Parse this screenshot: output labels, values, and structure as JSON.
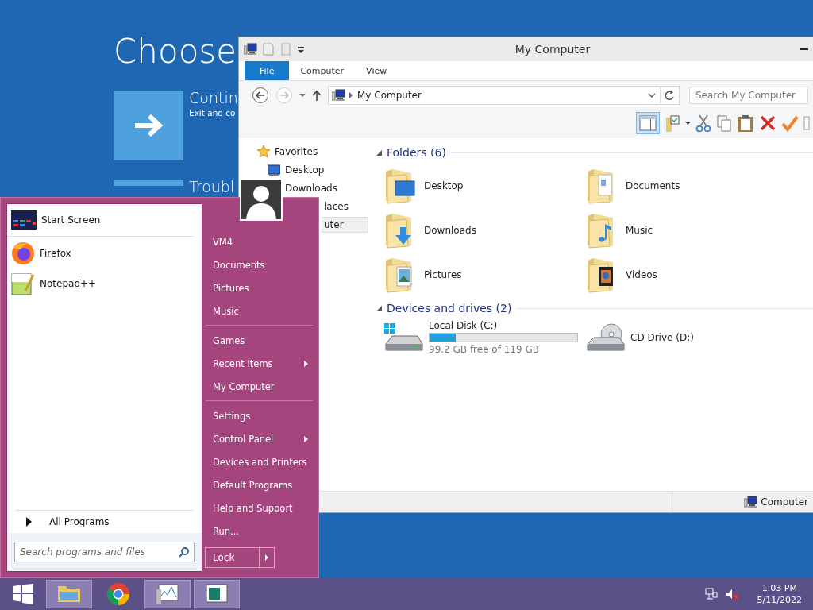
{
  "background_screen": {
    "title": "Choose",
    "options": [
      {
        "title": "Contin",
        "subtitle": "Exit and co",
        "kind": "continue"
      },
      {
        "title": "Troubl",
        "kind": "tools"
      }
    ]
  },
  "explorer": {
    "title": "My Computer",
    "tabs": [
      {
        "label": "File",
        "selected": true
      },
      {
        "label": "Computer",
        "selected": false
      },
      {
        "label": "View",
        "selected": false
      }
    ],
    "address": "My Computer",
    "search": {
      "placeholder": "Search My Computer"
    },
    "preview_pane": {
      "on": true
    },
    "nav_pane": [
      {
        "label": "Favorites",
        "kind": "group",
        "selected": false
      },
      {
        "label": "Desktop",
        "kind": "item",
        "selected": false
      },
      {
        "label": "Downloads",
        "kind": "item",
        "selected": false
      },
      {
        "label": "laces",
        "kind": "fragment",
        "selected": false
      },
      {
        "label": "uter",
        "kind": "fragment",
        "selected": true
      }
    ],
    "folders": {
      "header": "Folders (6)",
      "items": [
        {
          "label": "Desktop",
          "kind": "desktop"
        },
        {
          "label": "Documents",
          "kind": "documents"
        },
        {
          "label": "Downloads",
          "kind": "downloads"
        },
        {
          "label": "Music",
          "kind": "music"
        },
        {
          "label": "Pictures",
          "kind": "pictures"
        },
        {
          "label": "Videos",
          "kind": "videos"
        }
      ]
    },
    "drives": {
      "header": "Devices and drives (2)",
      "items": [
        {
          "label": "Local Disk (C:)",
          "kind": "disk",
          "level": 0.18,
          "detail": "99.2 GB free of 119 GB"
        },
        {
          "label": "CD Drive (D:)",
          "kind": "cd"
        }
      ]
    },
    "status_bar": {
      "label": "Computer"
    }
  },
  "start_menu": {
    "pinned": [
      {
        "label": "Start Screen",
        "kind": "start"
      },
      {
        "label": "Firefox",
        "kind": "firefox"
      },
      {
        "label": "Notepad++",
        "kind": "notepad"
      }
    ],
    "all_programs": "All Programs",
    "search": {
      "placeholder": "Search programs and files"
    },
    "places": [
      {
        "items": [
          {
            "label": "VM4",
            "has_submenu": false
          },
          {
            "label": "Documents",
            "has_submenu": false
          },
          {
            "label": "Pictures",
            "has_submenu": false
          },
          {
            "label": "Music",
            "has_submenu": false
          }
        ]
      },
      {
        "items": [
          {
            "label": "Games",
            "has_submenu": false
          },
          {
            "label": "Recent Items",
            "has_submenu": true
          },
          {
            "label": "My Computer",
            "has_submenu": false
          }
        ]
      },
      {
        "items": [
          {
            "label": "Settings",
            "has_submenu": false
          },
          {
            "label": "Control Panel",
            "has_submenu": true
          },
          {
            "label": "Devices and Printers",
            "has_submenu": false
          },
          {
            "label": "Default Programs",
            "has_submenu": false
          },
          {
            "label": "Help and Support",
            "has_submenu": false
          },
          {
            "label": "Run...",
            "has_submenu": false
          }
        ]
      }
    ],
    "power_button": "Lock"
  },
  "taskbar": {
    "tasks": [
      {
        "kind": "explorer",
        "open": true
      },
      {
        "kind": "chrome",
        "open": false
      },
      {
        "kind": "monitor",
        "open": true
      },
      {
        "kind": "window",
        "open": true
      }
    ],
    "clock": {
      "time": "1:03 PM",
      "date": "5/11/2022"
    }
  }
}
